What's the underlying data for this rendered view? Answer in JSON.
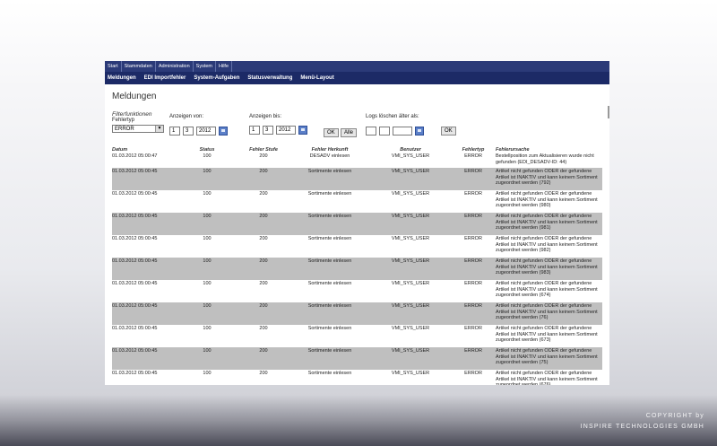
{
  "topnav": [
    "Start",
    "Stammdaten",
    "Administration",
    "System",
    "Hilfe"
  ],
  "subnav": [
    "Meldungen",
    "EDI Importfehler",
    "System-Aufgaben",
    "Statusverwaltung",
    "Menü-Layout"
  ],
  "page_title": "Meldungen",
  "filter_section": "Filterfunktionen",
  "filters": {
    "fehlertyp_label": "Fehlertyp",
    "fehlertyp_value": "ERROR",
    "von_label": "Anzeigen von:",
    "von_day": "1",
    "von_month": "3",
    "von_year": "2012",
    "bis_label": "Anzeigen bis:",
    "bis_day": "1",
    "bis_month": "3",
    "bis_year": "2012",
    "ok_label": "OK",
    "alle_label": "Alle",
    "logs_label": "Logs löschen älter als:",
    "logs_ok_label": "OK"
  },
  "table": {
    "headers": [
      "Datum",
      "Status",
      "Fehler Stufe",
      "Fehler Herkunft",
      "Benutzer",
      "Fehlertyp",
      "Fehlerursache"
    ],
    "rows": [
      [
        "01.03.2012 05:00:47",
        "100",
        "200",
        "DESADV einlesen",
        "VMI_SYS_USER",
        "ERROR",
        "Bestellposition zum Aktualisieren wurde nicht gefunden (EDI_DESADV-ID: 44)"
      ],
      [
        "01.03.2012 05:00:45",
        "100",
        "200",
        "Sortimente einlesen",
        "VMI_SYS_USER",
        "ERROR",
        "Artikel nicht gefunden ODER der gefundene Artikel ist INAKTIV und kann keinem Sortiment zugeordnet werden (792)"
      ],
      [
        "01.03.2012 05:00:45",
        "100",
        "200",
        "Sortimente einlesen",
        "VMI_SYS_USER",
        "ERROR",
        "Artikel nicht gefunden ODER der gefundene Artikel ist INAKTIV und kann keinem Sortiment zugeordnet werden (980)"
      ],
      [
        "01.03.2012 05:00:45",
        "100",
        "200",
        "Sortimente einlesen",
        "VMI_SYS_USER",
        "ERROR",
        "Artikel nicht gefunden ODER der gefundene Artikel ist INAKTIV und kann keinem Sortiment zugeordnet werden (981)"
      ],
      [
        "01.03.2012 05:00:45",
        "100",
        "200",
        "Sortimente einlesen",
        "VMI_SYS_USER",
        "ERROR",
        "Artikel nicht gefunden ODER der gefundene Artikel ist INAKTIV und kann keinem Sortiment zugeordnet werden (982)"
      ],
      [
        "01.03.2012 05:00:45",
        "100",
        "200",
        "Sortimente einlesen",
        "VMI_SYS_USER",
        "ERROR",
        "Artikel nicht gefunden ODER der gefundene Artikel ist INAKTIV und kann keinem Sortiment zugeordnet werden (983)"
      ],
      [
        "01.03.2012 05:00:45",
        "100",
        "200",
        "Sortimente einlesen",
        "VMI_SYS_USER",
        "ERROR",
        "Artikel nicht gefunden ODER der gefundene Artikel ist INAKTIV und kann keinem Sortiment zugeordnet werden (674)"
      ],
      [
        "01.03.2012 05:00:45",
        "100",
        "200",
        "Sortimente einlesen",
        "VMI_SYS_USER",
        "ERROR",
        "Artikel nicht gefunden ODER der gefundene Artikel ist INAKTIV und kann keinem Sortiment zugeordnet werden (76)"
      ],
      [
        "01.03.2012 05:00:45",
        "100",
        "200",
        "Sortimente einlesen",
        "VMI_SYS_USER",
        "ERROR",
        "Artikel nicht gefunden ODER der gefundene Artikel ist INAKTIV und kann keinem Sortiment zugeordnet werden (673)"
      ],
      [
        "01.03.2012 05:00:45",
        "100",
        "200",
        "Sortimente einlesen",
        "VMI_SYS_USER",
        "ERROR",
        "Artikel nicht gefunden ODER der gefundene Artikel ist INAKTIV und kann keinem Sortiment zugeordnet werden (75)"
      ],
      [
        "01.03.2012 05:00:45",
        "100",
        "200",
        "Sortimente einlesen",
        "VMI_SYS_USER",
        "ERROR",
        "Artikel nicht gefunden ODER der gefundene Artikel ist INAKTIV und kann keinem Sortiment zugeordnet werden (676)"
      ]
    ]
  },
  "copyright": {
    "line1": "COPYRIGHT by",
    "line2": "INSPIRE TECHNOLOGIES GMBH"
  }
}
